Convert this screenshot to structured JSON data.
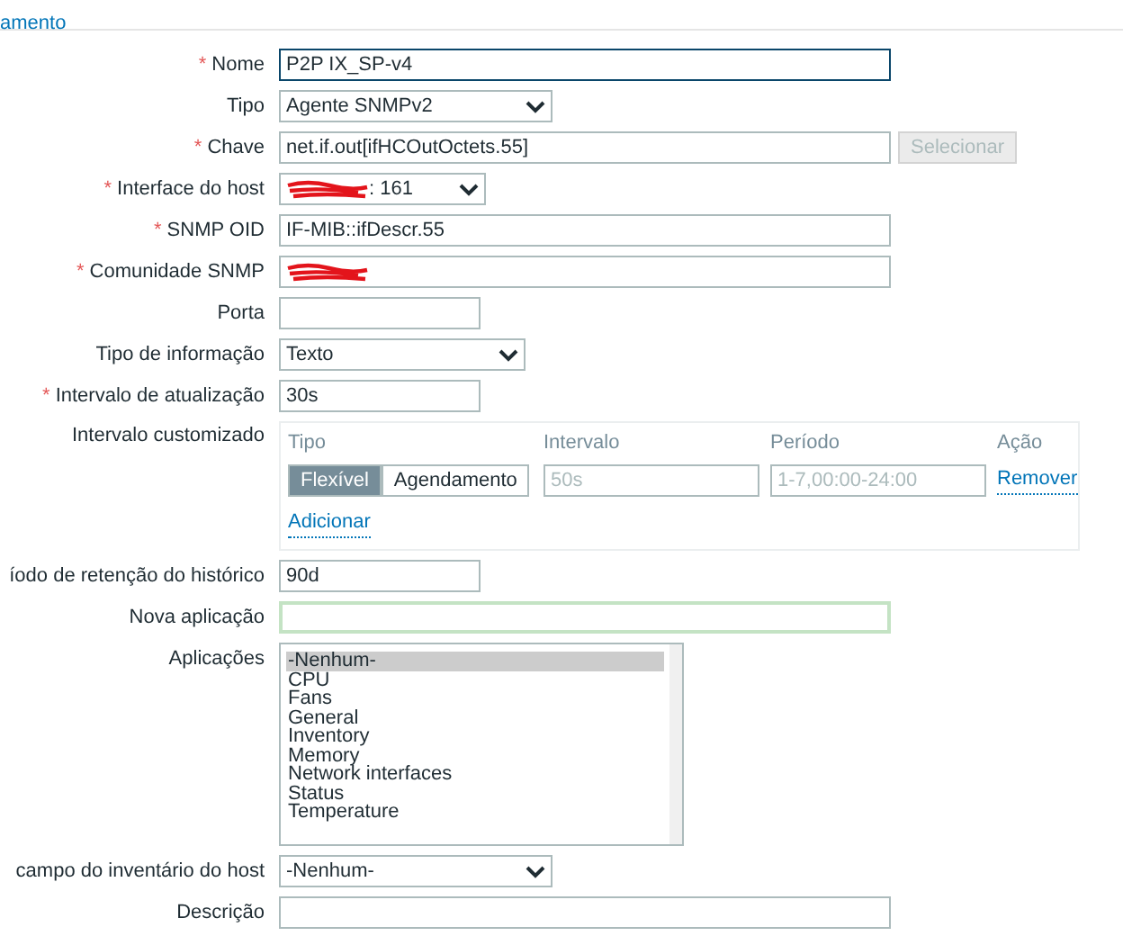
{
  "breadcrumb_link": "amento",
  "fields": [
    {
      "kind": "text",
      "label": "Nome",
      "marker": "*",
      "value": "P2P IX_SP-v4",
      "focused": true,
      "highlighted": false
    },
    {
      "kind": "select",
      "label": "Tipo",
      "value": "Agente SNMPv2"
    },
    {
      "kind": "text_button",
      "label": "Chave",
      "marker": "*",
      "value": "net.if.out[ifHCOutOctets.55]",
      "button": {
        "label": "Selecionar",
        "disabled": true
      },
      "focused": false,
      "highlighted": false
    },
    {
      "kind": "select",
      "label": "Interface do host",
      "marker": "*",
      "value": ": 161",
      "redacted": true
    },
    {
      "kind": "text",
      "label": "SNMP OID",
      "marker": "*",
      "value": "IF-MIB::ifDescr.55",
      "focused": false,
      "highlighted": false
    },
    {
      "kind": "text",
      "label": "Comunidade SNMP",
      "marker": "*",
      "redacted": true,
      "focused": false,
      "highlighted": false
    },
    {
      "kind": "text",
      "label": "Porta",
      "focused": false,
      "highlighted": false
    },
    {
      "kind": "select",
      "label": "Tipo de informação",
      "value": "Texto"
    },
    {
      "kind": "text",
      "label": "Intervalo de atualização",
      "marker": "*",
      "value": "30s",
      "focused": false,
      "highlighted": false
    },
    {
      "kind": "custom_interval",
      "label": "Intervalo customizado",
      "columns": [
        "Tipo",
        "Intervalo",
        "Período",
        "Ação"
      ],
      "rows": [
        {
          "modes": [
            {
              "label": "Flexível",
              "selected": true
            },
            {
              "label": "Agendamento",
              "selected": false
            }
          ],
          "interval_placeholder": "50s",
          "period_placeholder": "1-7,00:00-24:00",
          "action": "Remover"
        }
      ],
      "add_link": "Adicionar"
    },
    {
      "kind": "text",
      "label": "íodo de retenção do histórico",
      "value": "90d",
      "focused": false,
      "highlighted": false
    },
    {
      "kind": "text",
      "label": "Nova aplicação",
      "focused": false,
      "highlighted": true
    },
    {
      "kind": "listbox",
      "label": "Aplicações",
      "items": [
        {
          "label": "-Nenhum-",
          "selected": true
        },
        {
          "label": "CPU",
          "selected": false
        },
        {
          "label": "Fans",
          "selected": false
        },
        {
          "label": "General",
          "selected": false
        },
        {
          "label": "Inventory",
          "selected": false
        },
        {
          "label": "Memory",
          "selected": false
        },
        {
          "label": "Network interfaces",
          "selected": false
        },
        {
          "label": "Status",
          "selected": false
        },
        {
          "label": "Temperature",
          "selected": false
        }
      ]
    },
    {
      "kind": "select",
      "label": "campo do inventário do host",
      "value": "-Nenhum-"
    },
    {
      "kind": "textarea",
      "label": "Descrição"
    }
  ]
}
